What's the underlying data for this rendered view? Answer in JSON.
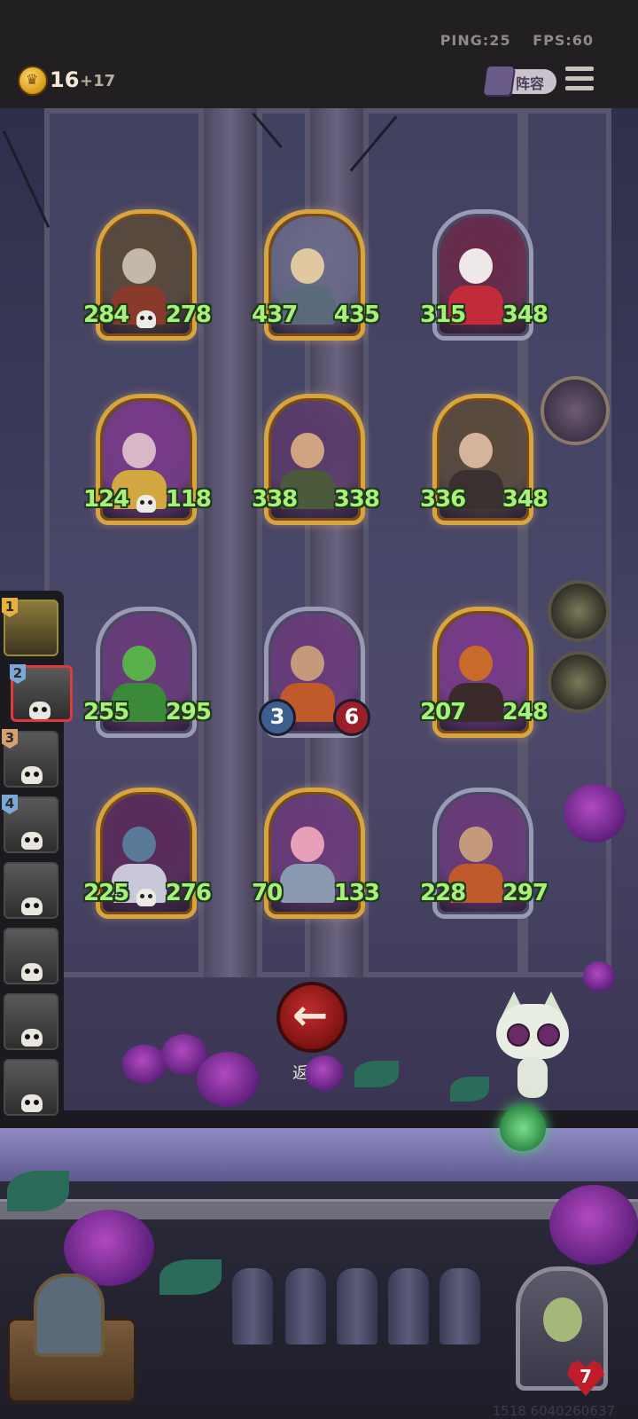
{
  "status": {
    "ping": "PING:25",
    "fps": "FPS:60"
  },
  "gold": {
    "amount": "16",
    "income": "+17"
  },
  "lineup_button": {
    "label": "阵容"
  },
  "back_button": {
    "label": "返回"
  },
  "board": {
    "cards": [
      {
        "name": "gunslinger-woman",
        "attack": "284",
        "health": "278",
        "frame": "gold",
        "skull": true,
        "palette": [
          "#5a4a3a",
          "#c4b9a8",
          "#8a3a2a"
        ]
      },
      {
        "name": "armored-knight",
        "attack": "437",
        "health": "435",
        "frame": "gold",
        "skull": false,
        "palette": [
          "#6a6a8a",
          "#e2c8a0",
          "#5a6a7a"
        ]
      },
      {
        "name": "clown",
        "attack": "315",
        "health": "348",
        "frame": "silver",
        "skull": false,
        "palette": [
          "#6a2a4a",
          "#efe8e8",
          "#c22c3a"
        ]
      },
      {
        "name": "horned-demon",
        "attack": "124",
        "health": "118",
        "frame": "gold",
        "skull": true,
        "palette": [
          "#7a3a8a",
          "#d8b8c8",
          "#d4a840"
        ]
      },
      {
        "name": "bearded-brute",
        "attack": "338",
        "health": "338",
        "frame": "gold",
        "skull": false,
        "palette": [
          "#5a3a6a",
          "#d0a480",
          "#4a5a3a"
        ]
      },
      {
        "name": "cook-woman",
        "attack": "336",
        "health": "348",
        "frame": "gold",
        "skull": false,
        "palette": [
          "#5a4a3a",
          "#d4b49a",
          "#3a3030"
        ]
      },
      {
        "name": "cactus",
        "attack": "255",
        "health": "295",
        "frame": "silver",
        "skull": false,
        "palette": [
          "#6a3a7a",
          "#5ab04a",
          "#3a8a3a"
        ]
      },
      {
        "name": "tree-ent",
        "attack": "3",
        "health": "6",
        "frame": "silver",
        "skull": false,
        "badges": true,
        "palette": [
          "#6a3a7a",
          "#c49a7a",
          "#c05a2a"
        ]
      },
      {
        "name": "pumpkin-monster",
        "attack": "207",
        "health": "248",
        "frame": "gold",
        "skull": false,
        "palette": [
          "#7a3a8a",
          "#c86a2a",
          "#3a2a2a"
        ]
      },
      {
        "name": "gargoyle",
        "attack": "225",
        "health": "276",
        "frame": "gold",
        "skull": true,
        "palette": [
          "#5a2a5a",
          "#5a7a9a",
          "#c8c8d8"
        ]
      },
      {
        "name": "valkyrie",
        "attack": "70",
        "health": "133",
        "frame": "gold",
        "skull": false,
        "palette": [
          "#6a3a7a",
          "#e8a0b8",
          "#8a9ab0"
        ]
      },
      {
        "name": "tree-ent-2",
        "attack": "228",
        "health": "297",
        "frame": "silver",
        "skull": false,
        "palette": [
          "#6a3a7a",
          "#c49a7a",
          "#c05a2a"
        ]
      }
    ]
  },
  "opponents": [
    {
      "rank": "1",
      "color": "#e8b040"
    },
    {
      "rank": "2",
      "color": "#7aa8d8"
    },
    {
      "rank": "3",
      "color": "#d8a070"
    },
    {
      "rank": "4",
      "color": "#7aa8d8"
    },
    {
      "rank": "",
      "color": ""
    },
    {
      "rank": "",
      "color": ""
    },
    {
      "rank": "",
      "color": ""
    },
    {
      "rank": "",
      "color": ""
    }
  ],
  "player": {
    "health": "7"
  },
  "session_id": "1518 6040260637"
}
